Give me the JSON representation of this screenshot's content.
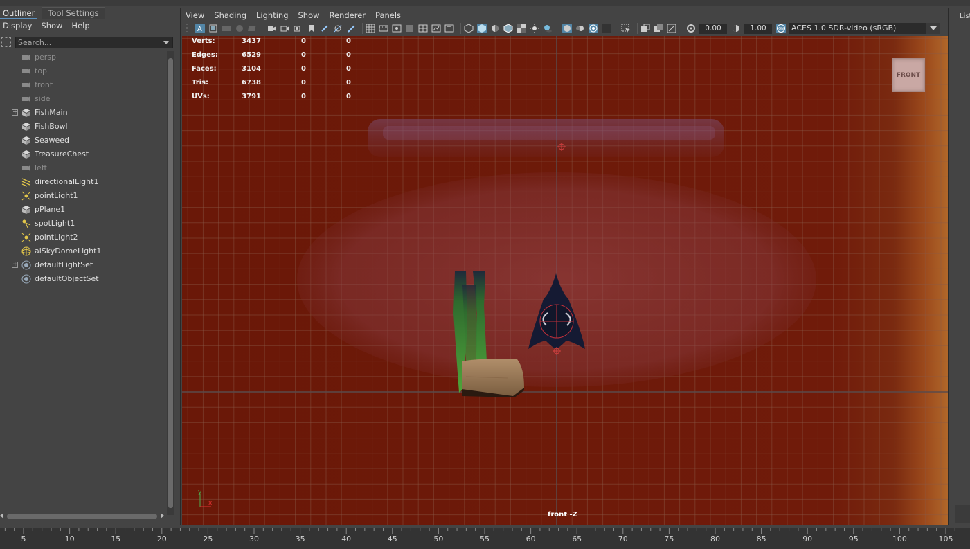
{
  "outliner": {
    "tabs": [
      {
        "label": "Outliner",
        "active": true
      },
      {
        "label": "Tool Settings",
        "active": false
      }
    ],
    "menu": [
      "Display",
      "Show",
      "Help"
    ],
    "search_placeholder": "Search...",
    "items": [
      {
        "label": "persp",
        "icon": "camera-icon",
        "dim": true,
        "expandable": false
      },
      {
        "label": "top",
        "icon": "camera-icon",
        "dim": true,
        "expandable": false
      },
      {
        "label": "front",
        "icon": "camera-icon",
        "dim": true,
        "expandable": false
      },
      {
        "label": "side",
        "icon": "camera-icon",
        "dim": true,
        "expandable": false
      },
      {
        "label": "FishMain",
        "icon": "transform-icon",
        "dim": false,
        "expandable": true
      },
      {
        "label": "FishBowl",
        "icon": "transform-icon",
        "dim": false,
        "expandable": false
      },
      {
        "label": "Seaweed",
        "icon": "transform-icon",
        "dim": false,
        "expandable": false
      },
      {
        "label": "TreasureChest",
        "icon": "transform-icon",
        "dim": false,
        "expandable": false
      },
      {
        "label": "left",
        "icon": "camera-icon",
        "dim": true,
        "expandable": false
      },
      {
        "label": "directionalLight1",
        "icon": "directional-light-icon",
        "dim": false,
        "expandable": false
      },
      {
        "label": "pointLight1",
        "icon": "point-light-icon",
        "dim": false,
        "expandable": false
      },
      {
        "label": "pPlane1",
        "icon": "transform-icon",
        "dim": false,
        "expandable": false
      },
      {
        "label": "spotLight1",
        "icon": "spot-light-icon",
        "dim": false,
        "expandable": false
      },
      {
        "label": "pointLight2",
        "icon": "point-light-icon",
        "dim": false,
        "expandable": false
      },
      {
        "label": "aiSkyDomeLight1",
        "icon": "sky-dome-light-icon",
        "dim": false,
        "expandable": false
      },
      {
        "label": "defaultLightSet",
        "icon": "set-icon",
        "dim": false,
        "expandable": true
      },
      {
        "label": "defaultObjectSet",
        "icon": "set-icon",
        "dim": false,
        "expandable": false
      }
    ]
  },
  "viewport": {
    "menu": [
      "View",
      "Shading",
      "Lighting",
      "Show",
      "Renderer",
      "Panels"
    ],
    "exposure": "0.00",
    "gamma": "1.00",
    "color_management": "ACES 1.0 SDR-video (sRGB)",
    "camera_label": "front -Z",
    "view_cube_label": "FRONT",
    "hud": [
      {
        "label": "Verts:",
        "values": [
          "3437",
          "0",
          "0"
        ]
      },
      {
        "label": "Edges:",
        "values": [
          "6529",
          "0",
          "0"
        ]
      },
      {
        "label": "Faces:",
        "values": [
          "3104",
          "0",
          "0"
        ]
      },
      {
        "label": "Tris:",
        "values": [
          "6738",
          "0",
          "0"
        ]
      },
      {
        "label": "UVs:",
        "values": [
          "3791",
          "0",
          "0"
        ]
      }
    ],
    "axis_labels": {
      "y": "y",
      "x": "x"
    },
    "colors": {
      "background": "#6a1808",
      "grid": "#8a5a4a",
      "accent": "#5285a6"
    }
  },
  "right_panel": {
    "label": "List"
  },
  "timeline": {
    "ticks": [
      "5",
      "10",
      "15",
      "20",
      "25",
      "30",
      "35",
      "40",
      "45",
      "50",
      "55",
      "60",
      "65",
      "70",
      "75",
      "80",
      "85",
      "90",
      "95",
      "100",
      "105"
    ]
  }
}
